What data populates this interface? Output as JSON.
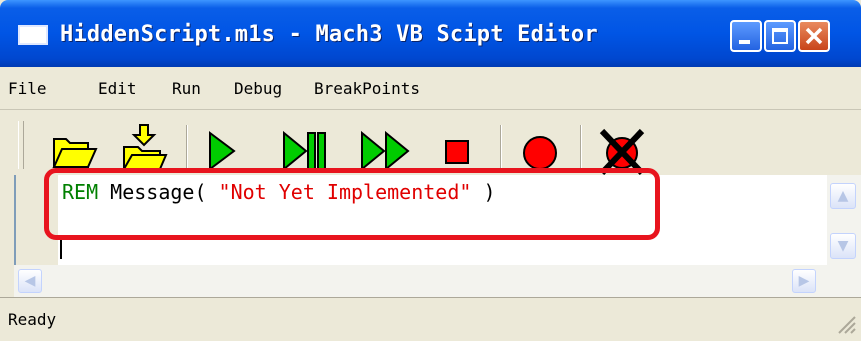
{
  "window": {
    "title": "HiddenScript.m1s - Mach3 VB Scipt Editor",
    "accent_color": "#0055e5",
    "icons": [
      "app-icon",
      "minimize-icon",
      "maximize-icon",
      "close-icon"
    ]
  },
  "menu": {
    "items": [
      "File",
      "Edit",
      "Run",
      "Debug",
      "BreakPoints"
    ]
  },
  "toolbar": {
    "tools": [
      "open-folder-icon",
      "save-icon",
      "run-icon",
      "step-icon",
      "fast-forward-icon",
      "stop-icon",
      "breakpoint-icon",
      "clear-breakpoint-icon"
    ]
  },
  "editor": {
    "keyword": "REM",
    "text": " Message( ",
    "string": "\"Not Yet Implemented\"",
    "closing": " )",
    "colors": {
      "keyword": "#008000",
      "string": "#e00000",
      "highlight": "#e8141e"
    }
  },
  "status": {
    "text": "Ready"
  }
}
